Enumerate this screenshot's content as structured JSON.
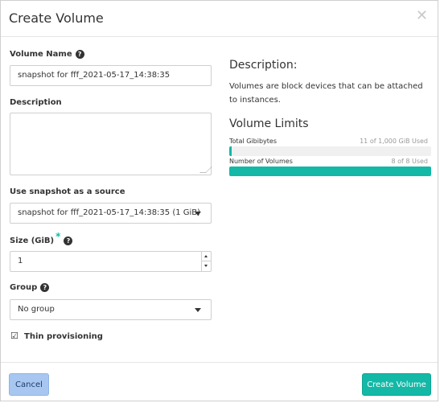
{
  "dialog": {
    "title": "Create Volume",
    "close_icon": "close-icon"
  },
  "form": {
    "volume_name": {
      "label": "Volume Name",
      "value": "snapshot for fff_2021-05-17_14:38:35"
    },
    "description": {
      "label": "Description",
      "value": ""
    },
    "source": {
      "label": "Use snapshot as a source",
      "selected": "snapshot for fff_2021-05-17_14:38:35 (1 GiB)"
    },
    "size": {
      "label": "Size (GiB)",
      "required_mark": "*",
      "value": "1"
    },
    "group": {
      "label": "Group",
      "selected": "No group"
    },
    "thin_provisioning": {
      "label": "Thin provisioning",
      "checked": true,
      "check_glyph": "☑"
    }
  },
  "info": {
    "description_title": "Description:",
    "description_text": "Volumes are block devices that can be attached to instances.",
    "limits_title": "Volume Limits",
    "limits": [
      {
        "label": "Total Gibibytes",
        "used_text": "11 of 1,000 GiB Used",
        "fraction": 0.011
      },
      {
        "label": "Number of Volumes",
        "used_text": "8 of 8 Used",
        "fraction": 1.0
      }
    ]
  },
  "footer": {
    "cancel_label": "Cancel",
    "create_label": "Create Volume"
  },
  "colors": {
    "accent": "#14b8a6",
    "cancel_bg": "#a8c7f0"
  }
}
